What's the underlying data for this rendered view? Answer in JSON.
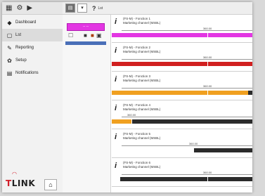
{
  "app": {
    "logo": "TLINK",
    "logo_accent": "#d11f2a"
  },
  "sidebar": {
    "top_icons": [
      "grid-icon",
      "gear-icon",
      "play-icon"
    ],
    "items": [
      {
        "label": "Dashboard",
        "icon": "dashboard-icon",
        "active": false
      },
      {
        "label": "Lst",
        "icon": "list-icon",
        "active": true
      },
      {
        "label": "Reporting",
        "icon": "report-icon",
        "active": false
      },
      {
        "label": "Setup",
        "icon": "gear-icon",
        "active": false
      },
      {
        "label": "Notifications",
        "icon": "bell-icon",
        "active": false
      }
    ]
  },
  "toolbar": {
    "help": "?",
    "label": "Lst"
  },
  "editor": {
    "bar_label": "-- --",
    "bar_color": "#e336e3"
  },
  "meters": [
    {
      "title": "(FS-M) - Fonction 1",
      "subtitle": "Marketing channel (MSBL)",
      "value_label": "360.00",
      "fill": 1.0,
      "color": "#e336e3",
      "marker": 0.68
    },
    {
      "title": "(FS-M) - Fonction 2",
      "subtitle": "Marketing channel (MSBL)",
      "value_label": "360.00",
      "fill": 1.0,
      "color": "#d12020",
      "marker": 0.68
    },
    {
      "title": "(FS-M) - Fonction 3",
      "subtitle": "Marketing channel (MSBL)",
      "value_label": "360.00",
      "fill": 0.97,
      "color": "#f0a020",
      "marker": 0.68
    },
    {
      "title": "(FS-M) - Fonction 4",
      "subtitle": "Marketing channel (MSBL)",
      "value_label": "360.00",
      "fill": 0.14,
      "color": "#f0a020",
      "marker": 0.14
    },
    {
      "title": "(FS-M) - Fonction 5",
      "subtitle": "Marketing channel (MSBL)",
      "value_label": "360.00",
      "fill": 0.58,
      "color": "#ffffff",
      "marker": 0.58
    },
    {
      "title": "(FS-M) - Fonction 6",
      "subtitle": "Marketing channel (MSBL)",
      "value_label": "360.00",
      "fill": 0.06,
      "color": "#ffffff",
      "marker": 0.68
    }
  ]
}
